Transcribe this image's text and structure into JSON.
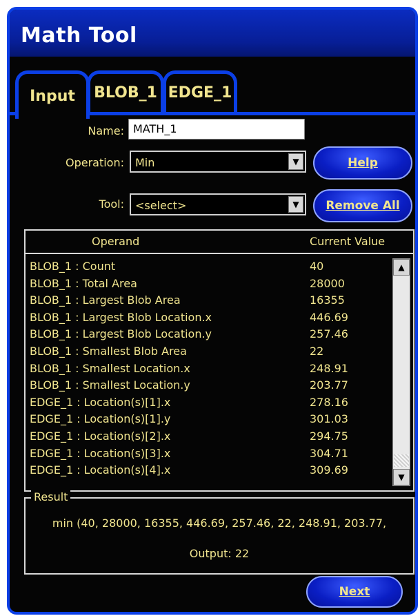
{
  "window": {
    "title": "Math Tool"
  },
  "tabs": [
    {
      "label": "Input"
    },
    {
      "label": "BLOB_1"
    },
    {
      "label": "EDGE_1"
    }
  ],
  "form": {
    "name_label": "Name:",
    "name_value": "MATH_1",
    "operation_label": "Operation:",
    "operation_value": "Min",
    "tool_label": "Tool:",
    "tool_value": "<select>"
  },
  "buttons": {
    "help": "Help",
    "remove_all": "Remove All",
    "next": "Next"
  },
  "operand_list": {
    "headers": {
      "operand": "Operand",
      "current_value": "Current Value"
    },
    "rows": [
      {
        "operand": "BLOB_1 : Count",
        "value": "40"
      },
      {
        "operand": "BLOB_1 : Total Area",
        "value": "28000"
      },
      {
        "operand": "BLOB_1 : Largest Blob Area",
        "value": "16355"
      },
      {
        "operand": "BLOB_1 : Largest Blob Location.x",
        "value": "446.69"
      },
      {
        "operand": "BLOB_1 : Largest Blob Location.y",
        "value": "257.46"
      },
      {
        "operand": "BLOB_1 : Smallest Blob Area",
        "value": "22"
      },
      {
        "operand": "BLOB_1 : Smallest Location.x",
        "value": "248.91"
      },
      {
        "operand": "BLOB_1 : Smallest Location.y",
        "value": "203.77"
      },
      {
        "operand": "EDGE_1 : Location(s)[1].x",
        "value": "278.16"
      },
      {
        "operand": "EDGE_1 : Location(s)[1].y",
        "value": "301.03"
      },
      {
        "operand": "EDGE_1 : Location(s)[2].x",
        "value": "294.75"
      },
      {
        "operand": "EDGE_1 : Location(s)[3].x",
        "value": "304.71"
      },
      {
        "operand": "EDGE_1 : Location(s)[4].x",
        "value": "309.69"
      }
    ]
  },
  "result": {
    "legend": "Result",
    "expression": "min (40, 28000, 16355, 446.69, 257.46, 22, 248.91, 203.77,",
    "output": "Output: 22"
  },
  "icons": {
    "dropdown": "chevron-down-icon",
    "scroll_up": "arrow-up-icon",
    "scroll_down": "arrow-down-icon"
  },
  "colors": {
    "accent_blue": "#0b3fe6",
    "text_yellow": "#f1e58f",
    "background": "#050505"
  }
}
